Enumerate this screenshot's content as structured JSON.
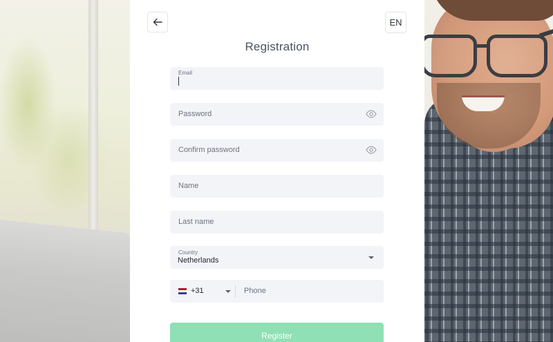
{
  "header": {
    "back_icon": "arrow-left-icon",
    "language": "EN",
    "title": "Registration"
  },
  "form": {
    "email": {
      "label": "Email",
      "value": ""
    },
    "password": {
      "placeholder": "Password",
      "icon": "eye-icon"
    },
    "confirm_password": {
      "placeholder": "Confirm password",
      "icon": "eye-icon"
    },
    "name": {
      "placeholder": "Name"
    },
    "last_name": {
      "placeholder": "Last name"
    },
    "country": {
      "label": "Country",
      "value": "Netherlands",
      "icon": "chevron-down-icon"
    },
    "phone": {
      "flag_icon": "netherlands-flag-icon",
      "code": "+31",
      "placeholder": "Phone"
    },
    "submit_label": "Register"
  },
  "colors": {
    "field_bg": "#f3f4f8",
    "button_bg": "#8fe0b4",
    "title": "#4a5160"
  }
}
